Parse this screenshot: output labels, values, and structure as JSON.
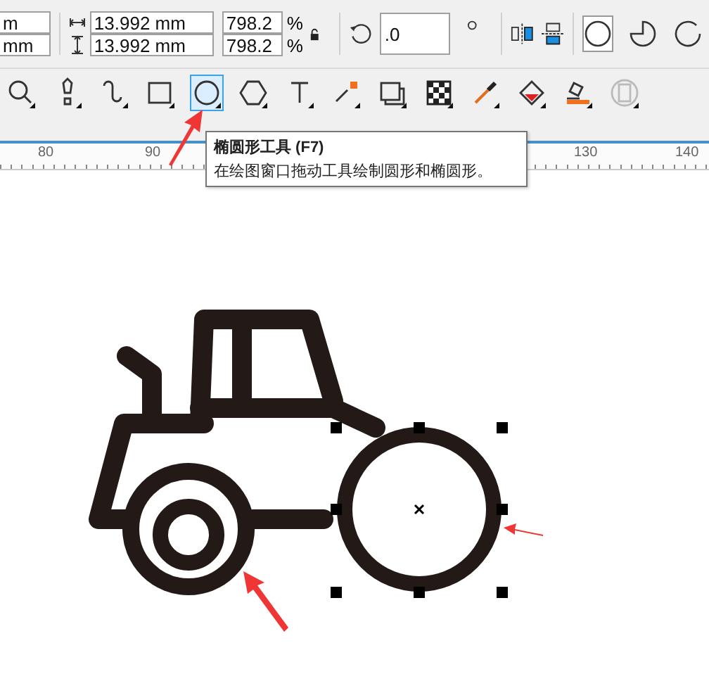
{
  "property_bar": {
    "position_fields": [
      "m",
      "mm"
    ],
    "size_fields": [
      {
        "kind": "width",
        "value": "13.992 mm",
        "scale": "798.2",
        "unit": "%"
      },
      {
        "kind": "height",
        "value": "13.992 mm",
        "scale": "798.2",
        "unit": "%"
      }
    ],
    "lock_scale": false,
    "rotation": ".0",
    "shape_modes": [
      {
        "kind": "ellipse",
        "selected": true
      },
      {
        "kind": "pie",
        "selected": false
      },
      {
        "kind": "arc",
        "selected": false
      }
    ]
  },
  "toolbox": [
    {
      "kind": "zoom",
      "selected": false
    },
    {
      "kind": "pen",
      "selected": false
    },
    {
      "kind": "freehand",
      "selected": false
    },
    {
      "kind": "rectangle",
      "selected": false
    },
    {
      "kind": "ellipse",
      "selected": true
    },
    {
      "kind": "polygon",
      "selected": false
    },
    {
      "kind": "text",
      "selected": false
    },
    {
      "kind": "connector",
      "selected": false
    },
    {
      "kind": "shadow",
      "selected": false
    },
    {
      "kind": "transparency",
      "selected": false
    },
    {
      "kind": "eyedropper",
      "selected": false
    },
    {
      "kind": "fill",
      "selected": false
    },
    {
      "kind": "smart-fill",
      "selected": false
    },
    {
      "kind": "disabled",
      "selected": false
    }
  ],
  "ruler": {
    "labels": [
      "80",
      "90",
      "130",
      "140"
    ]
  },
  "tooltip": {
    "title": "椭圆形工具 (F7)",
    "description": "在绘图窗口拖动工具绘制圆形和椭圆形。"
  }
}
